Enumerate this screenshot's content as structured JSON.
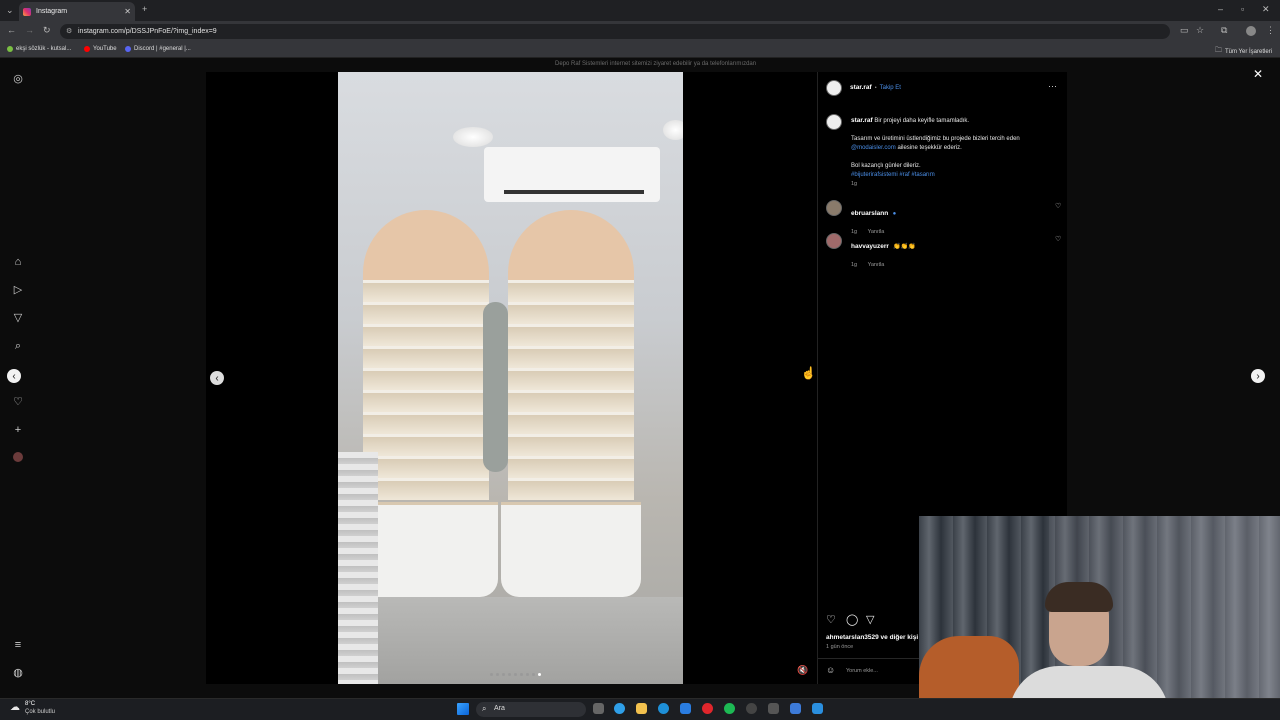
{
  "browser": {
    "tab_title": "Instagram",
    "url": "instagram.com/p/DSSJPnFoE/?img_index=9",
    "bookmarks": [
      "ekşi sözlük - kutsal...",
      "YouTube",
      "Discord | #general |...",
      "Tüm Yer İşaretleri"
    ]
  },
  "post": {
    "banner_text": "Depo Raf Sistemleri internet sitemizi ziyaret edebilir ya da telefonlarımızdan",
    "author": "star.raf",
    "follow_label": "Takip Et",
    "caption_lead": "Bir projeyi daha keyifle tamamladık.",
    "caption_line1": "Tasarım ve üretimini üstlendiğimiz bu projede bizleri tercih eden",
    "mention": "@modaisler.com",
    "caption_line2": "ailesine teşekkür ederiz.",
    "caption_line3": "Bol kazançlı günler dileriz.",
    "hashtags": "#bijuterirafsistemi #raf #tasarım",
    "caption_age": "1g",
    "comments": [
      {
        "user": "ebruarslann",
        "text": "",
        "age": "1g",
        "reply": "Yanıtla"
      },
      {
        "user": "havvayuzerr",
        "text": "👏👏👏",
        "age": "1g",
        "reply": "Yanıtla"
      }
    ],
    "likes_text": "ahmetarslan3529 ve diğer kişi",
    "time_ago": "1 gün önce",
    "comment_placeholder": "Yorum ekle...",
    "image_count_dots": 9,
    "active_dot": 8
  },
  "taskbar": {
    "weather_temp": "8°C",
    "weather_desc": "Çok bulutlu",
    "search_label": "Ara"
  },
  "colors": {
    "accent": "#4b8fe8"
  }
}
